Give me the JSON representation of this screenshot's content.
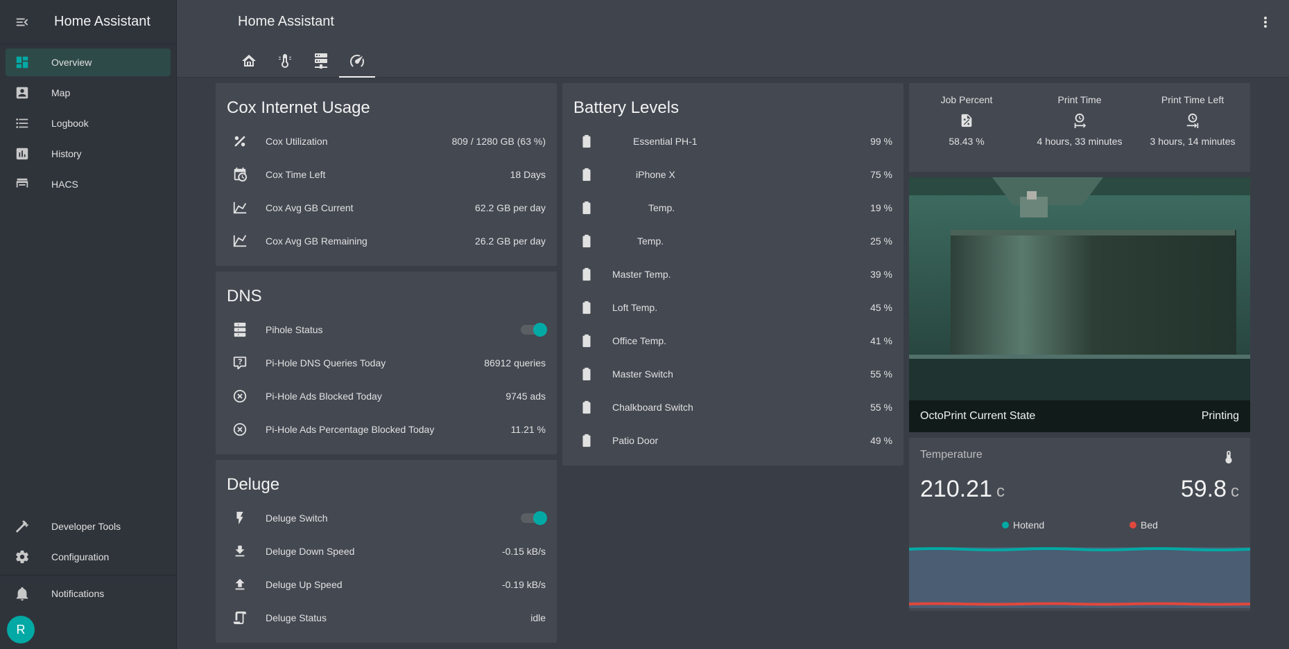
{
  "sidebar": {
    "title": "Home Assistant",
    "items": [
      {
        "label": "Overview",
        "icon": "dashboard-icon"
      },
      {
        "label": "Map",
        "icon": "account-box-icon"
      },
      {
        "label": "Logbook",
        "icon": "list-icon"
      },
      {
        "label": "History",
        "icon": "chart-box-icon"
      },
      {
        "label": "HACS",
        "icon": "hacs-icon"
      }
    ],
    "bottom": [
      {
        "label": "Developer Tools",
        "icon": "hammer-icon"
      },
      {
        "label": "Configuration",
        "icon": "gear-icon"
      }
    ],
    "notifications": "Notifications",
    "user_initial": "R"
  },
  "header": {
    "title": "Home Assistant",
    "tabs": [
      "home-icon",
      "thermometer-icon",
      "server-icon",
      "speedometer-icon"
    ]
  },
  "cox": {
    "title": "Cox Internet Usage",
    "rows": [
      {
        "name": "Cox Utilization",
        "value": "809 / 1280 GB (63 %)"
      },
      {
        "name": "Cox Time Left",
        "value": "18 Days"
      },
      {
        "name": "Cox Avg GB Current",
        "value": "62.2 GB per day"
      },
      {
        "name": "Cox Avg GB Remaining",
        "value": "26.2 GB per day"
      }
    ]
  },
  "dns": {
    "title": "DNS",
    "rows": [
      {
        "name": "Pihole Status",
        "value": ""
      },
      {
        "name": "Pi-Hole DNS Queries Today",
        "value": "86912 queries"
      },
      {
        "name": "Pi-Hole Ads Blocked Today",
        "value": "9745 ads"
      },
      {
        "name": "Pi-Hole Ads Percentage Blocked Today",
        "value": "11.21 %"
      }
    ]
  },
  "deluge": {
    "title": "Deluge",
    "rows": [
      {
        "name": "Deluge Switch",
        "value": ""
      },
      {
        "name": "Deluge Down Speed",
        "value": "-0.15 kB/s"
      },
      {
        "name": "Deluge Up Speed",
        "value": "-0.19 kB/s"
      },
      {
        "name": "Deluge Status",
        "value": "idle"
      }
    ]
  },
  "battery": {
    "title": "Battery Levels",
    "rows": [
      {
        "name": "Essential PH-1",
        "value": "99 %"
      },
      {
        "name": "iPhone X",
        "value": "75 %"
      },
      {
        "name": "Temp.",
        "value": "19 %"
      },
      {
        "name": "Temp.",
        "value": "25 %"
      },
      {
        "name": "Master Temp.",
        "value": "39 %"
      },
      {
        "name": "Loft Temp.",
        "value": "45 %"
      },
      {
        "name": "Office Temp.",
        "value": "41 %"
      },
      {
        "name": "Master Switch",
        "value": "55 %"
      },
      {
        "name": "Chalkboard Switch",
        "value": "55 %"
      },
      {
        "name": "Patio Door",
        "value": "49 %"
      }
    ]
  },
  "printer": {
    "stats": [
      {
        "title": "Job Percent",
        "value": "58.43 %",
        "icon": "file-percent-icon"
      },
      {
        "title": "Print Time",
        "value": "4 hours, 33 minutes",
        "icon": "clock-start-icon"
      },
      {
        "title": "Print Time Left",
        "value": "3 hours, 14 minutes",
        "icon": "clock-end-icon"
      }
    ],
    "camera_label": "OctoPrint Current State",
    "camera_state": "Printing"
  },
  "temperature": {
    "title": "Temperature",
    "hotend_value": "210.21",
    "bed_value": "59.8",
    "unit": "c",
    "legend": [
      "Hotend",
      "Bed"
    ]
  },
  "colors": {
    "accent": "#03a9a4",
    "bed": "#e0483d",
    "graph_fill": "#4a5d73"
  }
}
